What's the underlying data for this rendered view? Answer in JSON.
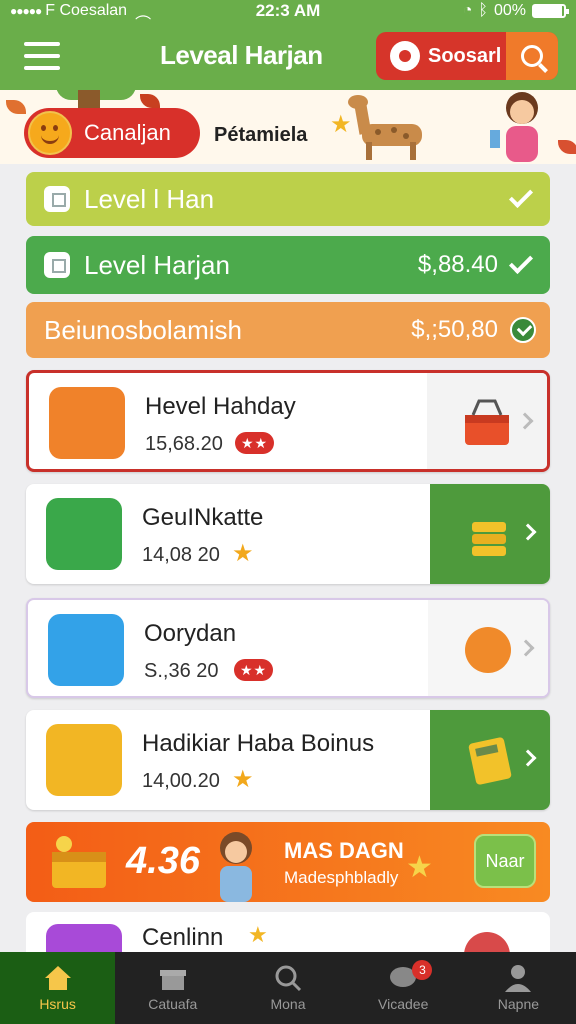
{
  "status_bar": {
    "carrier": "F Coesalan",
    "time": "22:3 AM",
    "battery": "00%"
  },
  "header": {
    "title": "Leveal Harjan",
    "action_label": "Soosarl",
    "menu_icon": "hamburger-icon",
    "search_icon": "search-icon"
  },
  "banner": {
    "pill_label": "Canaljan",
    "subtitle": "Pétamiela"
  },
  "rows": [
    {
      "label": "Level l Han",
      "amount": "",
      "color": "#bcd04a"
    },
    {
      "label": "Level Harjan",
      "amount": "$,88.40",
      "color": "#4caa4c"
    },
    {
      "label": "Beiunosbolamish",
      "amount": "$,;50,80",
      "color": "#f0a050"
    }
  ],
  "cards": [
    {
      "name": "Hevel Hahday",
      "price": "15,68.20",
      "rating": "★★",
      "icon": "shopping-cart-icon",
      "color": "#f0822a"
    },
    {
      "name": "GeuINkatte",
      "price": "14,08 20",
      "rating": "★",
      "icon": "coins-icon",
      "color": "#3aa84a"
    },
    {
      "name": "Oorydan",
      "price": "S.,36 20",
      "rating": "★★",
      "icon": "tools-icon",
      "color": "#33a2e8"
    },
    {
      "name": "Hadikiar Haba Boinus",
      "price": "14,00.20",
      "rating": "★",
      "icon": "gift-box-icon",
      "color": "#f2b624"
    }
  ],
  "promo": {
    "amount": "4.36",
    "title": "MAS DAGN",
    "subtitle": "Madesphbladly",
    "button": "Naar"
  },
  "partial_card": {
    "name": "Cenlinn"
  },
  "tabs": [
    {
      "label": "Hsrus",
      "icon": "home-icon"
    },
    {
      "label": "Catuafa",
      "icon": "gift-icon"
    },
    {
      "label": "Mona",
      "icon": "search-icon"
    },
    {
      "label": "Vicadee",
      "icon": "chat-icon",
      "badge": "3"
    },
    {
      "label": "Napne",
      "icon": "profile-icon"
    }
  ],
  "colors": {
    "brand_green": "#6aae4a",
    "accent_red": "#d8302a",
    "accent_orange": "#f07a2a"
  }
}
